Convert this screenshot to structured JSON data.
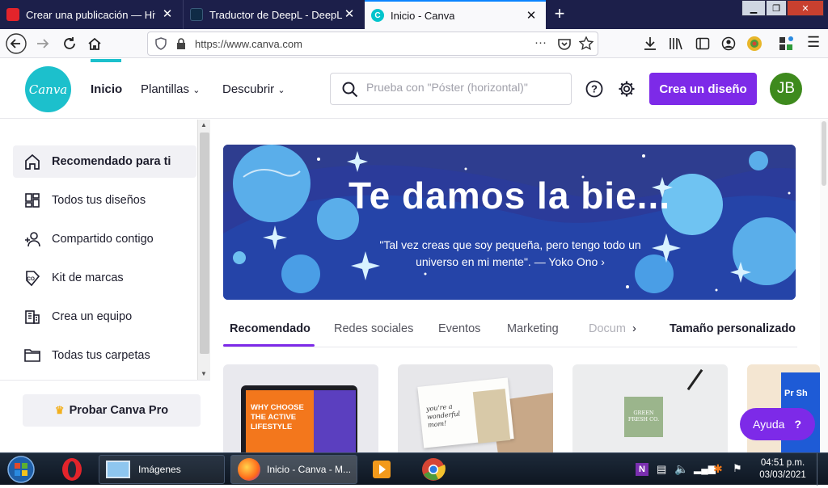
{
  "browser": {
    "tabs": [
      {
        "title": "Crear una publicación — Hive",
        "favicon_color": "#e3242b"
      },
      {
        "title": "Traductor de DeepL - DeepL Tr",
        "favicon_color": "#0f2b46"
      },
      {
        "title": "Inicio - Canva",
        "favicon_color": "#00c4cc"
      }
    ],
    "url": "https://www.canva.com",
    "page_actions": "···"
  },
  "canva": {
    "logo_text": "Canva",
    "nav": {
      "inicio": "Inicio",
      "plantillas": "Plantillas",
      "descubrir": "Descubrir"
    },
    "search_placeholder": "Prueba con \"Póster (horizontal)\"",
    "create_button": "Crea un diseño",
    "avatar_initials": "JB",
    "brand_color": "#7d2ae8"
  },
  "sidebar": {
    "items": [
      {
        "label": "Recomendado para ti",
        "icon": "home-icon"
      },
      {
        "label": "Todos tus diseños",
        "icon": "grid-icon"
      },
      {
        "label": "Compartido contigo",
        "icon": "users-icon"
      },
      {
        "label": "Kit de marcas",
        "icon": "brand-kit-icon"
      },
      {
        "label": "Crea un equipo",
        "icon": "building-icon"
      },
      {
        "label": "Todas tus carpetas",
        "icon": "folder-icon"
      }
    ],
    "pro_button": "Probar Canva Pro"
  },
  "banner": {
    "title": "Te damos la bie...",
    "quote": "\"Tal vez creas que soy pequeña, pero tengo todo un universo en mi mente\". — Yoko Ono ›"
  },
  "categories": {
    "items": [
      "Recomendado",
      "Redes sociales",
      "Eventos",
      "Marketing",
      "Docum"
    ],
    "custom_size": "Tamaño personalizado"
  },
  "cards": {
    "card1_text": "WHY CHOOSE THE ACTIVE LIFESTYLE",
    "card2_text": "you're a wonderful mom!",
    "card3_text": "GREEN FRESH CO.",
    "card4_text": "Pr Sh"
  },
  "help_button": {
    "label": "Ayuda",
    "symbol": "?"
  },
  "taskbar": {
    "apps": [
      {
        "label": "Imágenes"
      },
      {
        "label": "Inicio - Canva - M..."
      }
    ],
    "time": "04:51 p.m.",
    "date": "03/03/2021"
  }
}
